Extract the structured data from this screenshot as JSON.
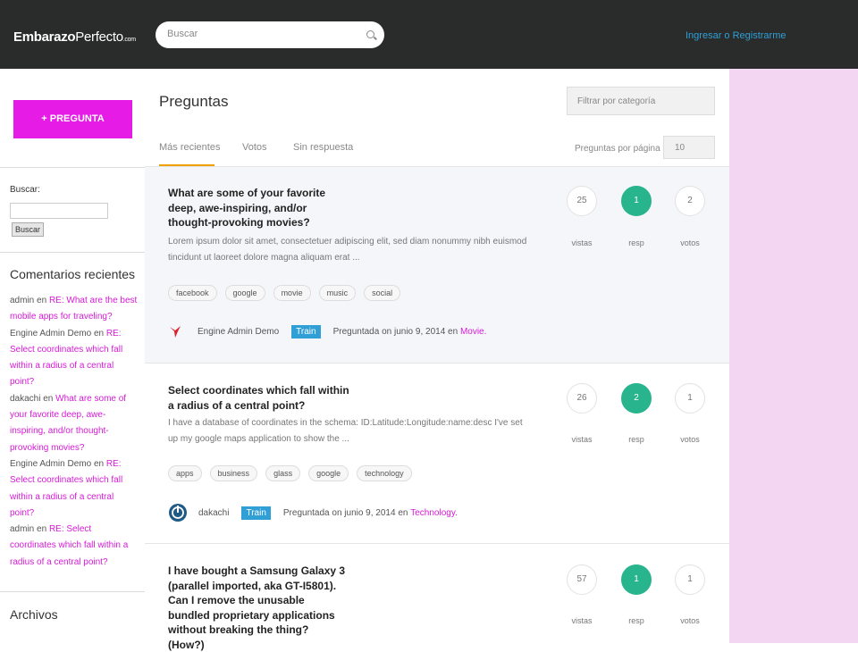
{
  "header": {
    "logo_bold": "Embarazo",
    "logo_light": "Perfecto",
    "logo_com": ".com",
    "search_placeholder": "Buscar",
    "login_link": "Ingresar o Registrarme"
  },
  "sidebar": {
    "question_button": "+ PREGUNTA",
    "search_label": "Buscar:",
    "search_button": "Buscar",
    "comments_title": "Comentarios recientes",
    "comments": [
      {
        "author": "admin",
        "sep": " en ",
        "link": "RE: What are the best mobile apps for traveling?"
      },
      {
        "author": "Engine Admin Demo",
        "sep": " en ",
        "link": "RE: Select coordinates which fall within a radius of a central point?"
      },
      {
        "author": "dakachi",
        "sep": " en ",
        "link": "What are some of your favorite deep, awe-inspiring, and/or thought-provoking movies?"
      },
      {
        "author": "Engine Admin Demo",
        "sep": " en ",
        "link": "RE: Select coordinates which fall within a radius of a central point?"
      },
      {
        "author": "admin",
        "sep": " en ",
        "link": "RE: Select coordinates which fall within a radius of a central point?"
      }
    ],
    "archives_title": "Archivos"
  },
  "main": {
    "title": "Preguntas",
    "filter_placeholder": "Filtrar por categoría",
    "tabs": [
      "Más recientes",
      "Votos",
      "Sin respuesta"
    ],
    "per_page_label": "Preguntas por página",
    "per_page_value": "10",
    "questions": [
      {
        "title": "What are some of your favorite deep, awe-inspiring, and/or thought-provoking movies?",
        "excerpt": "Lorem ipsum dolor sit amet, consectetuer adipiscing elit, sed diam nonummy nibh euismod tincidunt ut laoreet dolore magna aliquam erat ...",
        "tags": [
          "facebook",
          "google",
          "movie",
          "music",
          "social"
        ],
        "author": "Engine Admin Demo",
        "badge": "Train",
        "asked": "Preguntada on junio 9, 2014 en",
        "category": "Movie.",
        "views": "25",
        "answers": "1",
        "votes": "2"
      },
      {
        "title": "Select coordinates which fall within a radius of a central point?",
        "excerpt": "I have a database of coordinates in the schema: ID:Latitude:Longitude:name:desc I've set up my google maps application to show the ...",
        "tags": [
          "apps",
          "business",
          "glass",
          "google",
          "technology"
        ],
        "author": "dakachi",
        "badge": "Train",
        "asked": "Preguntada on junio 9, 2014 en",
        "category": "Technology.",
        "views": "26",
        "answers": "2",
        "votes": "1"
      },
      {
        "title": "I have bought a Samsung Galaxy 3 (parallel imported, aka GT-I5801). Can I remove the unusable bundled proprietary applications without breaking the thing? (How?)",
        "views": "57",
        "answers": "1",
        "votes": "1"
      }
    ],
    "stat_labels": {
      "views": "vistas",
      "answers": "resp",
      "votes": "votos"
    }
  },
  "colors": {
    "topbar": "#2a2c2b",
    "accent_magenta": "#e61ce6",
    "badge_blue": "#2f9fd6",
    "answer_green": "#28b48c",
    "pink_panel": "#f2d6f2"
  }
}
